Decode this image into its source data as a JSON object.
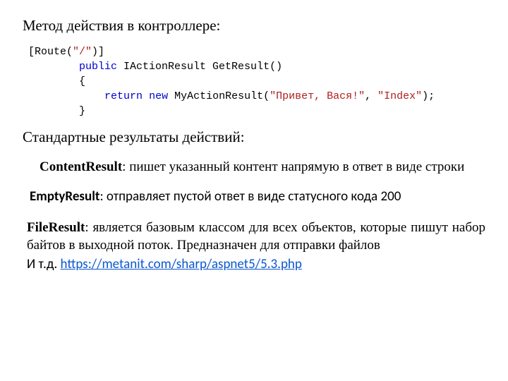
{
  "heading": "Метод действия в контроллере:",
  "code": {
    "l1_a": "[Route(",
    "l1_b": "\"/\"",
    "l1_c": ")]",
    "l2_a": "        ",
    "l2_b": "public",
    "l2_c": " IActionResult GetResult()",
    "l3": "        {",
    "l4_a": "            ",
    "l4_b": "return",
    "l4_c": " ",
    "l4_d": "new",
    "l4_e": " MyActionResult(",
    "l4_f": "\"Привет, Вася!\"",
    "l4_g": ", ",
    "l4_h": "\"Index\"",
    "l4_i": ");",
    "l5": "        }"
  },
  "subheading": "Стандартные результаты действий:",
  "content_result": {
    "name": "ContentResult",
    "desc": ": пишет указанный контент напрямую в ответ в виде строки"
  },
  "empty_result": {
    "name": "EmptyResult",
    "desc": ": отправляет пустой ответ в виде статусного кода 200"
  },
  "file_result": {
    "name": "FileResult",
    "desc": ": является базовым классом для всех объектов, которые пишут набор байтов в выходной поток. Предназначен для отправки файлов"
  },
  "etc": {
    "prefix": "И т.д. ",
    "url": "https://metanit.com/sharp/aspnet5/5.3.php"
  }
}
